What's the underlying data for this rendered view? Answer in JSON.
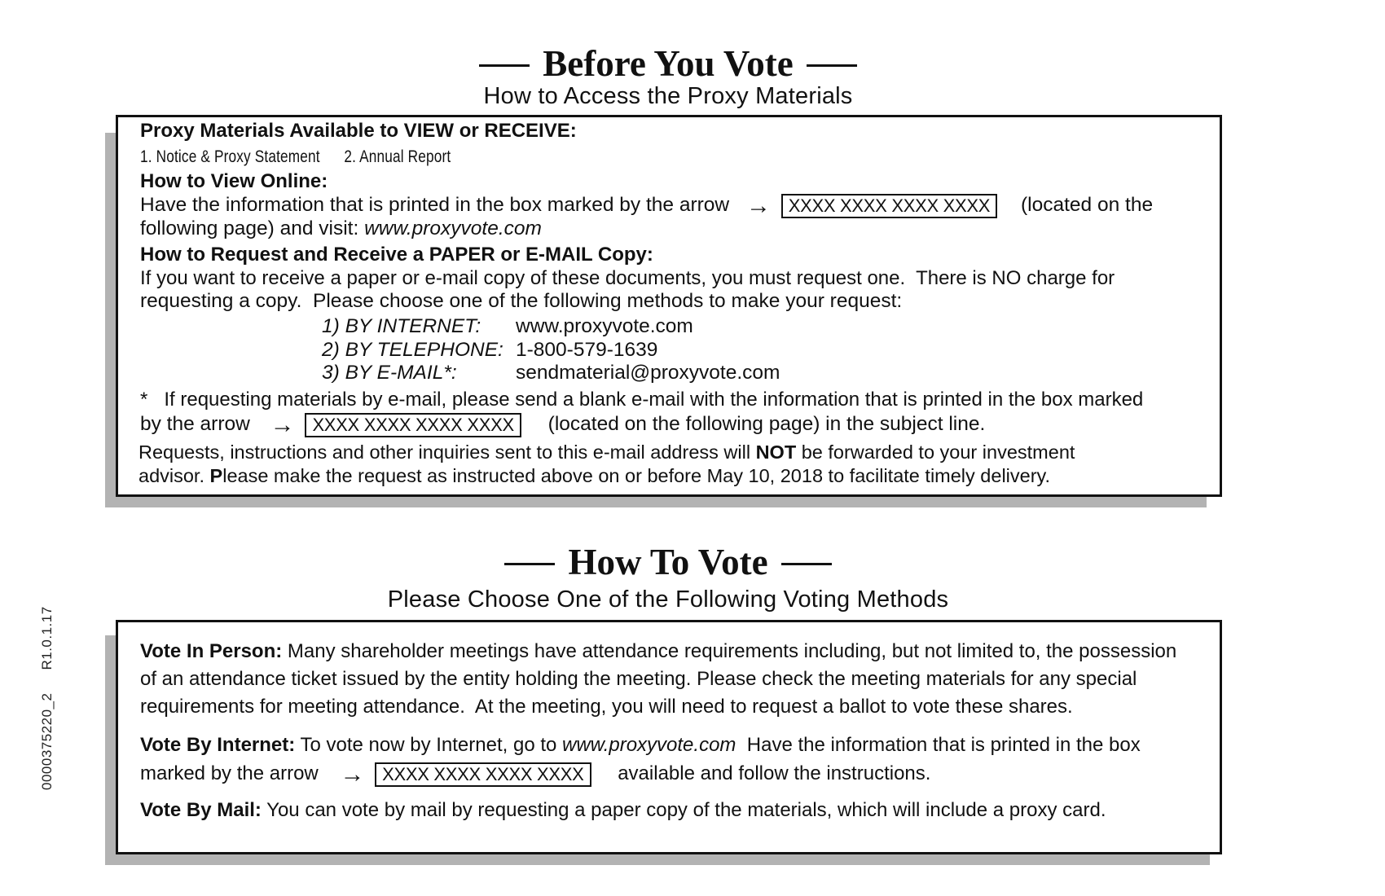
{
  "before_you_vote": {
    "title": "Before You Vote",
    "subtitle": "How to Access the Proxy Materials",
    "materials_heading": "Proxy Materials Available to VIEW or RECEIVE:",
    "materials_list": "1. Notice & Proxy Statement      2. Annual Report",
    "view_online_heading": "How to View Online:",
    "view_online_text_1": "Have the information that is printed in the box marked by the arrow",
    "control_number": "XXXX XXXX XXXX XXXX",
    "view_online_text_2": "(located on the",
    "view_online_text_3": "following page) and visit: ",
    "view_online_url": "www.proxyvote.com",
    "request_heading": "How to Request and Receive a PAPER or E-MAIL Copy:",
    "request_text_1": "If you want to receive a paper or e-mail copy of these documents, you must request one.  There is NO charge for",
    "request_text_2": "requesting a copy.  Please choose one of the following methods to make your request:",
    "methods": [
      {
        "label": "1) BY INTERNET:",
        "value": "www.proxyvote.com"
      },
      {
        "label": "2) BY TELEPHONE:",
        "value": "1-800-579-1639"
      },
      {
        "label": "3) BY E-MAIL*:",
        "value": "sendmaterial@proxyvote.com"
      }
    ],
    "email_note_1": "*   If requesting materials by e-mail, please send a blank e-mail with the information that is printed in the box marked",
    "email_note_2a": "by the arrow",
    "email_note_2b": "(located on the following page) in the subject line.",
    "requests_text_1a": "Requests, instructions and other inquiries sent to this e-mail address will ",
    "requests_text_1b": "NOT",
    "requests_text_1c": " be forwarded to your investment",
    "requests_text_2a": "advisor. ",
    "requests_text_2b": "P",
    "requests_text_2c": "lease make the request as instructed above on or before ",
    "requests_deadline": "May 10, 2018",
    "requests_text_2d": " to facilitate timely delivery."
  },
  "how_to_vote": {
    "title": "How To Vote",
    "subtitle": "Please Choose One of the Following Voting Methods",
    "in_person_label": "Vote In Person:",
    "in_person_text_1": " Many shareholder meetings have attendance requirements including, but not limited to, the possession",
    "in_person_text_2": "of an attendance ticket issued by the entity holding the meeting. Please check the meeting materials for any special",
    "in_person_text_3": "requirements for meeting attendance.  At the meeting, you will need to request a ballot to vote these shares.",
    "internet_label": "Vote By Internet:",
    "internet_text_1a": " To vote now by Internet, go to ",
    "internet_url": "www.proxyvote.com",
    "internet_text_1b": "  Have the information that is printed in the box",
    "internet_text_2a": "marked by the arrow",
    "control_number": "XXXX XXXX XXXX XXXX",
    "internet_text_2b": "available and follow the instructions.",
    "mail_label": "Vote By Mail:",
    "mail_text": " You can vote by mail by requesting a paper copy of the materials, which will include a proxy card."
  },
  "side_code": {
    "job_number": "0000375220_2",
    "revision": "R1.0.1.17"
  },
  "icons": {
    "arrow": "→"
  }
}
